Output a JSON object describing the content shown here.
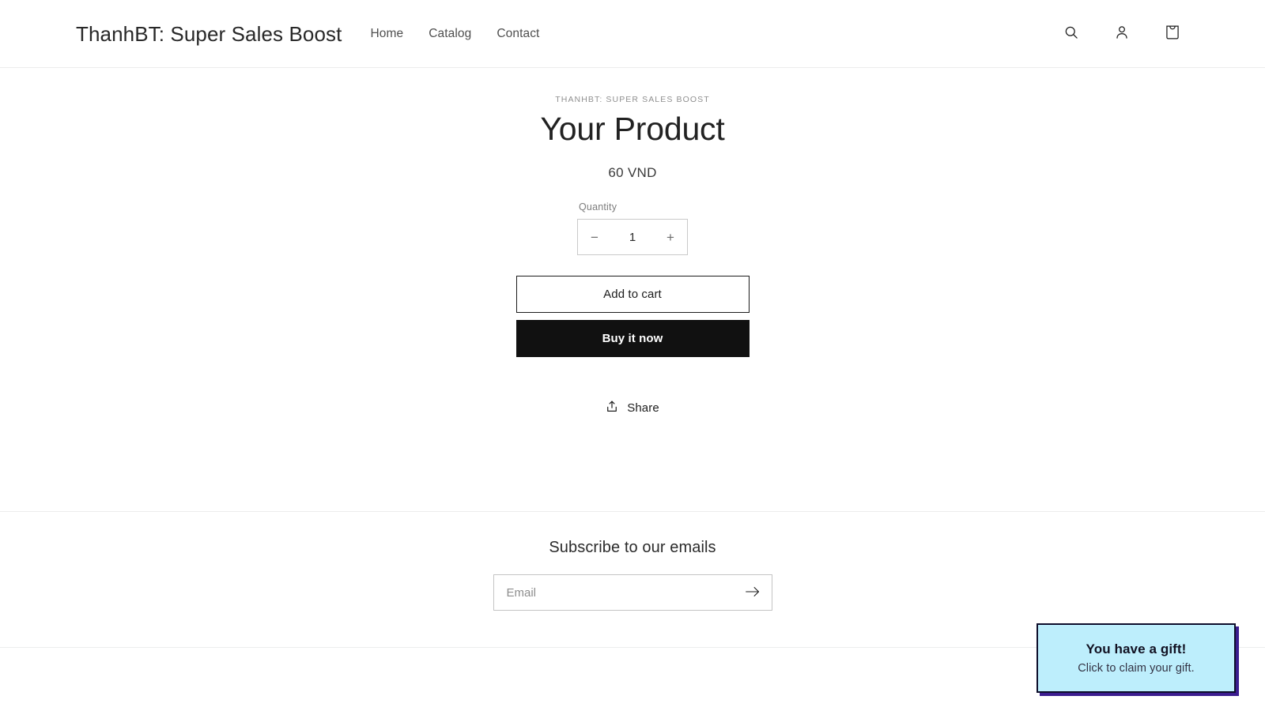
{
  "header": {
    "brand": "ThanhBT: Super Sales Boost",
    "nav": [
      {
        "label": "Home"
      },
      {
        "label": "Catalog"
      },
      {
        "label": "Contact"
      }
    ],
    "actions": [
      {
        "icon": "search-icon",
        "label": "Search"
      },
      {
        "icon": "account-icon",
        "label": "Log in"
      },
      {
        "icon": "cart-icon",
        "label": "Cart"
      }
    ]
  },
  "product": {
    "vendor": "THANHBT: SUPER SALES BOOST",
    "title": "Your Product",
    "price": "60 VND",
    "quantity": {
      "label": "Quantity",
      "value": "1",
      "decrease_label": "−",
      "increase_label": "+"
    },
    "add_to_cart_label": "Add to cart",
    "buy_now_label": "Buy it now",
    "share_label": "Share"
  },
  "newsletter": {
    "title": "Subscribe to our emails",
    "placeholder": "Email",
    "value": "",
    "submit_label": "Subscribe"
  },
  "gift_popup": {
    "title": "You have a gift!",
    "subtitle": "Click to claim your gift.",
    "background": "#bdeefc",
    "border": "#0d0d2b",
    "shadow": "#3b1d8f"
  }
}
